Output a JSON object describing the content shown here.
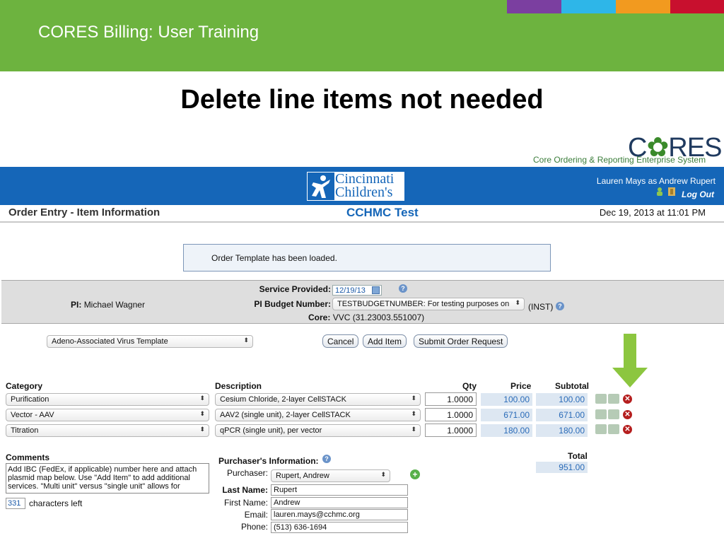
{
  "slide": {
    "header_title": "CORES Billing: User Training",
    "heading": "Delete line items not needed",
    "color_bars": [
      "#7b3fa0",
      "#2eb6e8",
      "#f29a1f",
      "#c8102e"
    ]
  },
  "cores_logo": {
    "text_c": "C",
    "text_o": "✿",
    "text_res": "RES",
    "tagline": "Core Ordering & Reporting Enterprise System"
  },
  "banner": {
    "hospital_name_1": "Cincinnati",
    "hospital_name_2": "Children's",
    "user": "Lauren Mays as Andrew Rupert",
    "logout": "Log Out"
  },
  "order_bar": {
    "title": "Order Entry - Item Information",
    "center": "CCHMC Test",
    "date": "Dec 19, 2013 at 11:01 PM"
  },
  "message": "Order Template has been loaded.",
  "info": {
    "pi_label": "PI:",
    "pi_value": "Michael Wagner",
    "service_label": "Service Provided:",
    "service_value": "12/19/13",
    "budget_label": "PI Budget Number:",
    "budget_value": "TESTBUDGETNUMBER: For testing purposes on",
    "budget_suffix": "(INST)",
    "core_label": "Core:",
    "core_value": "VVC (31.23003.551007)"
  },
  "template_select": "Adeno-Associated Virus Template",
  "buttons": {
    "cancel": "Cancel",
    "add_item": "Add Item",
    "submit": "Submit Order Request"
  },
  "columns": {
    "category": "Category",
    "description": "Description",
    "qty": "Qty",
    "price": "Price",
    "subtotal": "Subtotal"
  },
  "rows": [
    {
      "category": "Purification",
      "description": "Cesium Chloride, 2-layer CellSTACK",
      "qty": "1.0000",
      "price": "100.00",
      "subtotal": "100.00"
    },
    {
      "category": "Vector - AAV",
      "description": "AAV2 (single unit), 2-layer CellSTACK",
      "qty": "1.0000",
      "price": "671.00",
      "subtotal": "671.00"
    },
    {
      "category": "Titration",
      "description": "qPCR (single unit), per vector",
      "qty": "1.0000",
      "price": "180.00",
      "subtotal": "180.00"
    }
  ],
  "comments": {
    "label": "Comments",
    "text": "Add IBC (FedEx, if applicable) number here and attach plasmid map below. Use \"Add Item\" to add additional services. \"Multi unit\" versus \"single unit\" allows for",
    "chars_left_value": "331",
    "chars_left_label": "characters left"
  },
  "purchaser": {
    "section_label": "Purchaser's Information:",
    "purchaser_label": "Purchaser:",
    "purchaser_value": "Rupert, Andrew",
    "last_name_label": "Last Name:",
    "last_name": "Rupert",
    "first_name_label": "First Name:",
    "first_name": "Andrew",
    "email_label": "Email:",
    "email": "lauren.mays@cchmc.org",
    "phone_label": "Phone:",
    "phone": "(513) 636-1694"
  },
  "total": {
    "label": "Total",
    "value": "951.00"
  }
}
